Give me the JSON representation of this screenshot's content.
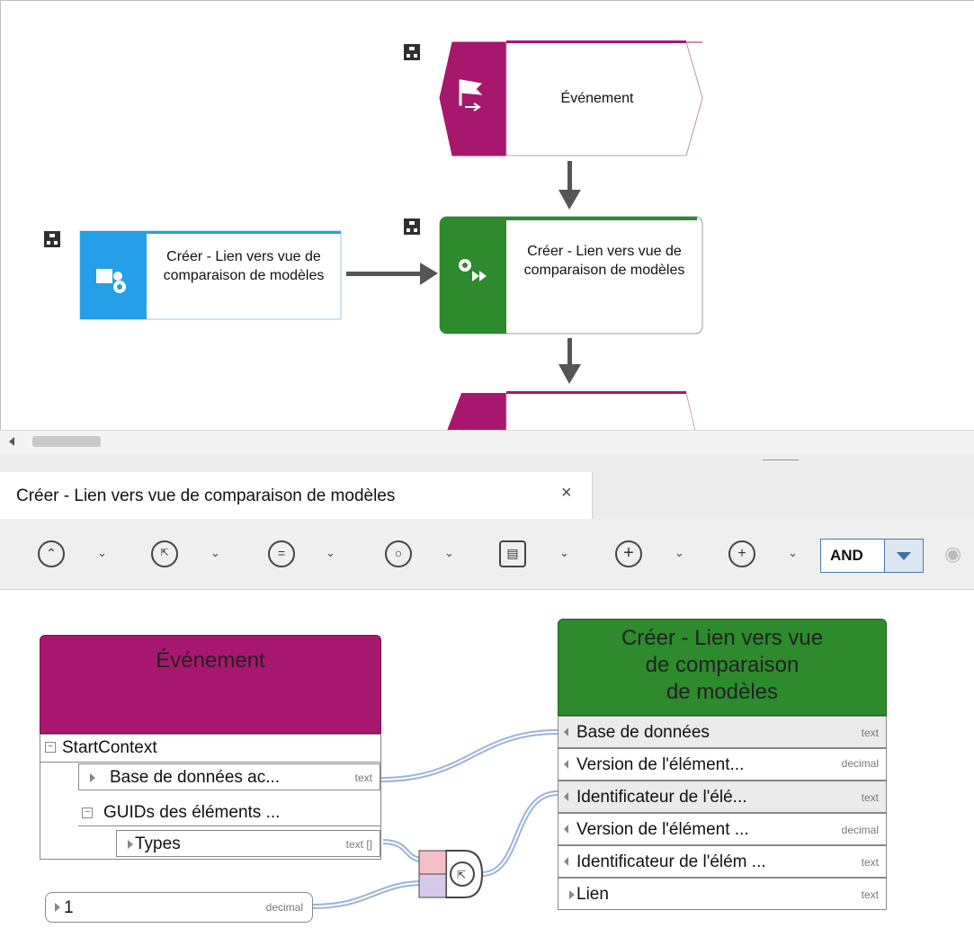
{
  "diagram": {
    "event_top_label": "Événement",
    "left_box_label": "Créer - Lien vers vue de comparaison de modèles",
    "main_box_label": "Créer - Lien vers vue de comparaison de modèles",
    "colors": {
      "event": "#a8176e",
      "function": "#2d8a2d",
      "interface": "#25a0e8"
    }
  },
  "tab": {
    "title": "Créer - Lien vers vue de comparaison de modèles",
    "close": "×"
  },
  "toolbar": {
    "tools": [
      "navigate-up-icon",
      "select-pointer-icon",
      "equals-icon",
      "timer-icon",
      "document-icon",
      "crosshair-plus-icon",
      "add-circle-icon"
    ],
    "and_label": "AND"
  },
  "mapping": {
    "event_node": {
      "title": "Événement",
      "rows": [
        {
          "label": "StartContext",
          "type": ""
        },
        {
          "label": "Base de données ac...",
          "type": "text"
        },
        {
          "label": "GUIDs des éléments ...",
          "type": ""
        },
        {
          "label": "Types",
          "type": "text []"
        }
      ]
    },
    "constant": {
      "label": "1",
      "type": "decimal"
    },
    "function_node": {
      "title": "Créer - Lien vers vue de comparaison de modèles",
      "title_lines": [
        "Créer - Lien vers vue",
        "de comparaison",
        "de modèles"
      ],
      "rows": [
        {
          "label": "Base de données",
          "type": "text"
        },
        {
          "label": "Version de l'élément...",
          "type": "decimal"
        },
        {
          "label": "Identificateur de l'élé...",
          "type": "text"
        },
        {
          "label": "Version de l'élément ...",
          "type": "decimal"
        },
        {
          "label": "Identificateur de l'élém ...",
          "type": "text"
        },
        {
          "label": "Lien",
          "type": "text"
        }
      ]
    }
  }
}
